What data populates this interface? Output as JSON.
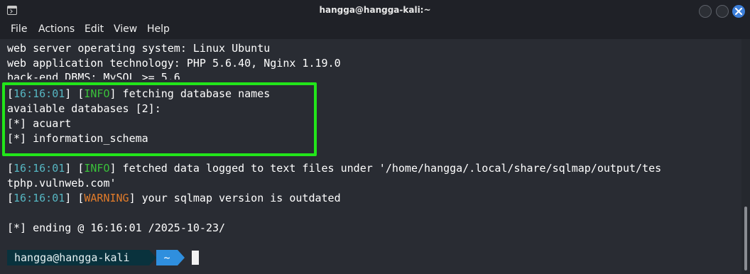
{
  "window": {
    "title": "hangga@hangga-kali:~"
  },
  "menu": {
    "items": [
      "File",
      "Actions",
      "Edit",
      "View",
      "Help"
    ]
  },
  "terminal": {
    "line1": "web server operating system: Linux Ubuntu",
    "line2": "web application technology: PHP 5.6.40, Nginx 1.19.0",
    "line3": "back-end DBMS: MySQL >= 5.6",
    "fetch_time": "16:16:01",
    "fetch_level": "INFO",
    "fetch_msg": " fetching database names",
    "available": "available databases [2]:",
    "db1": "[*] acuart",
    "db2": "[*] information_schema",
    "logged_time": "16:16:01",
    "logged_level": "INFO",
    "logged_msg": " fetched data logged to text files under '/home/hangga/.local/share/sqlmap/output/tes",
    "logged_cont": "tphp.vulnweb.com'",
    "warn_time": "16:16:01",
    "warn_level": "WARNING",
    "warn_msg": " your sqlmap version is outdated",
    "ending": "[*] ending @ 16:16:01 /2025-10-23/"
  },
  "prompt": {
    "user": "hangga@hangga-kali",
    "dir": "~"
  },
  "colors": {
    "timestamp": "#56b6c2",
    "info": "#3ac13a",
    "warning": "#e07b2a",
    "highlight": "#22e51a"
  }
}
